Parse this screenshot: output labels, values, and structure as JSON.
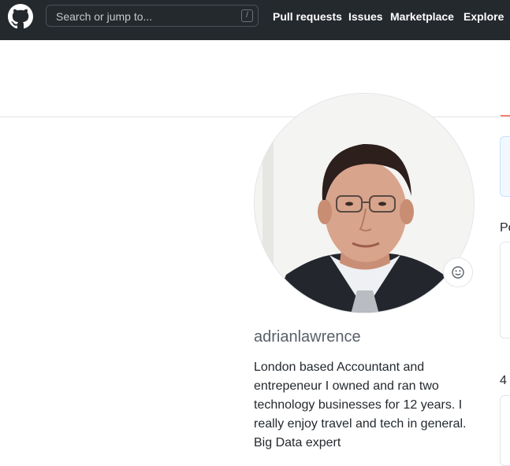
{
  "header": {
    "search": {
      "placeholder": "Search or jump to...",
      "shortcut_key": "/"
    },
    "nav": {
      "pull_requests": "Pull requests",
      "issues": "Issues",
      "marketplace": "Marketplace",
      "explore": "Explore"
    }
  },
  "profile": {
    "username": "adrianlawrence",
    "bio": "London based Accountant and entrepeneur I owned and ran two technology businesses for 12 years. I really enjoy travel and tech in general. Big Data expert"
  },
  "right_column": {
    "label_1": "Po",
    "label_2": "4"
  },
  "colors": {
    "header_bg": "#24292e",
    "tab_accent": "#f9826c",
    "muted_text": "#586069"
  }
}
